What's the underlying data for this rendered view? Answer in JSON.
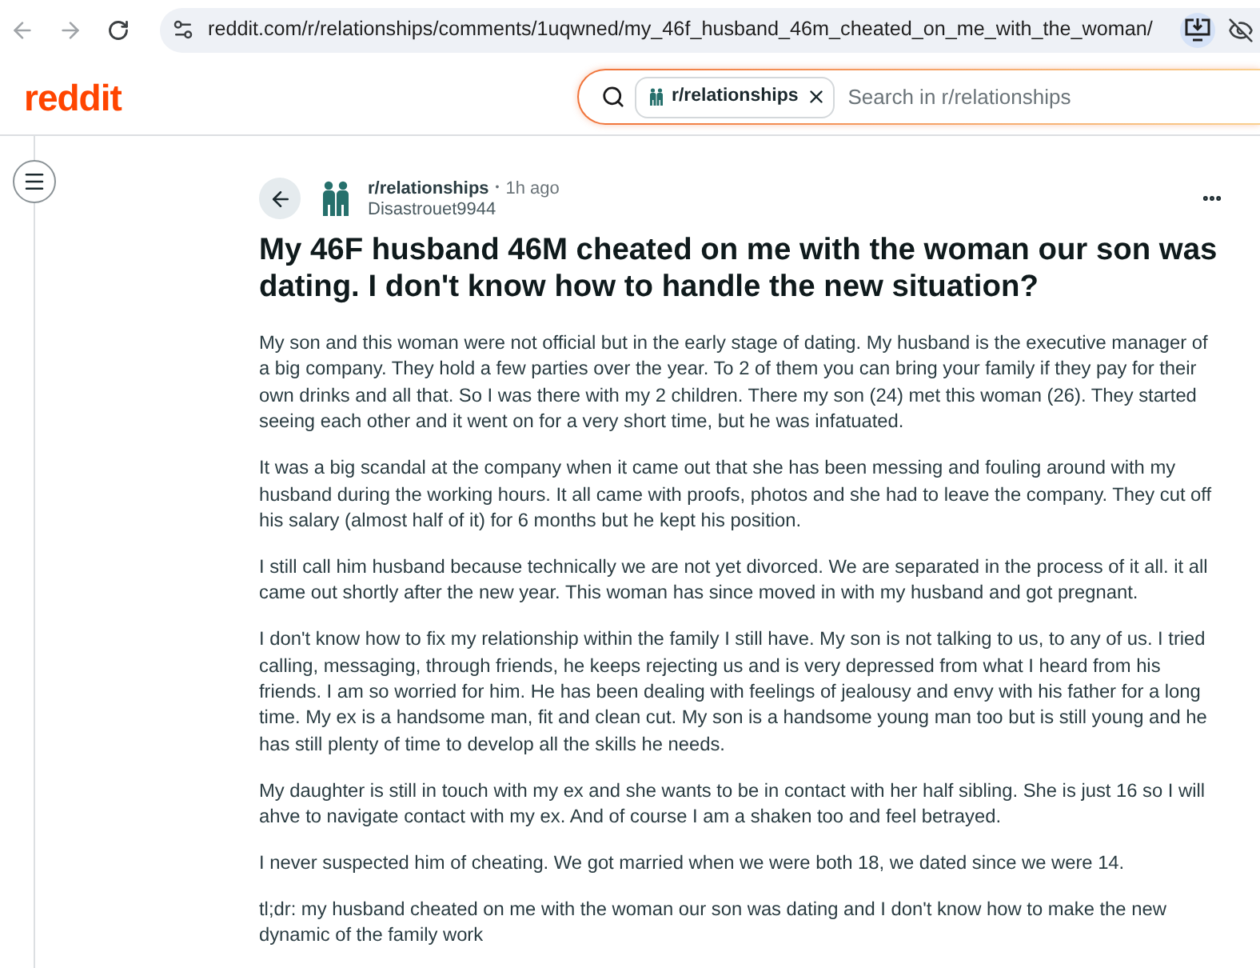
{
  "browser": {
    "url": "reddit.com/r/relationships/comments/1uqwned/my_46f_husband_46m_cheated_on_me_with_the_woman/"
  },
  "header": {
    "logo": "reddit",
    "search": {
      "chip": "r/relationships",
      "placeholder": "Search in r/relationships"
    }
  },
  "post": {
    "subreddit": "r/relationships",
    "separator": "•",
    "time": "1h ago",
    "author": "Disastrouet9944",
    "title": "My 46F husband 46M cheated on me with the woman our son was dating. I don't know how to handle the new situation?",
    "paragraphs": [
      "My son and this woman were not official but in the early stage of dating. My husband is the executive manager of a big company. They hold a few parties over the year. To 2 of them you can bring your family if they pay for their own drinks and all that. So I was there with my 2 children. There my son (24) met this woman (26). They started seeing each other and it went on for a very short time, but he was infatuated.",
      "It was a big scandal at the company when it came out that she has been messing and fouling around with my husband during the working hours. It all came with proofs, photos and she had to leave the company. They cut off his salary (almost half of it) for 6 months but he kept his position.",
      "I still call him husband because technically we are not yet divorced. We are separated in the process of it all. it all came out shortly after the new year. This woman has since moved in with my husband and got pregnant.",
      "I don't know how to fix my relationship within the family I still have. My son is not talking to us, to any of us. I tried calling, messaging, through friends, he keeps rejecting us and is very depressed from what I heard from his friends. I am so worried for him. He has been dealing with feelings of jealousy and envy with his father for a long time. My ex is a handsome man, fit and clean cut. My son is a handsome young man too but is still young and he has still plenty of time to develop all the skills he needs.",
      "My daughter is still in touch with my ex and she wants to be in contact with her half sibling. She is just 16 so I will ahve to navigate contact with my ex. And of course I am a shaken too and feel betrayed.",
      "I never suspected him of cheating. We got married when we were both 18, we dated since we were 14.",
      "tl;dr: my husband cheated on me with the woman our son was dating and I don't know how to make the new dynamic of the family work"
    ]
  }
}
